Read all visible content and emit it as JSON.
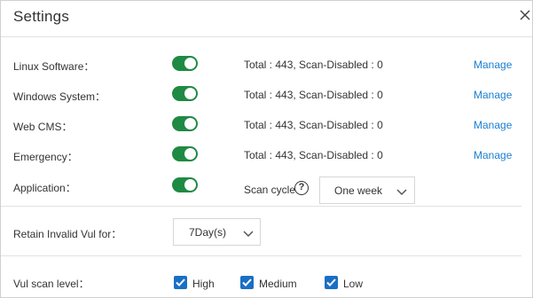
{
  "dialog": {
    "title": "Settings"
  },
  "rows": [
    {
      "label": "Linux Software：",
      "stats": "Total : 443, Scan-Disabled : 0",
      "action": "Manage",
      "enabled": true
    },
    {
      "label": "Windows System：",
      "stats": "Total : 443, Scan-Disabled : 0",
      "action": "Manage",
      "enabled": true
    },
    {
      "label": "Web CMS：",
      "stats": "Total : 443, Scan-Disabled : 0",
      "action": "Manage",
      "enabled": true
    },
    {
      "label": "Emergency：",
      "stats": "Total : 443, Scan-Disabled : 0",
      "action": "Manage",
      "enabled": true
    },
    {
      "label": "Application：",
      "enabled": true,
      "scan_cycle_label": "Scan cycle",
      "scan_cycle_value": "One week"
    }
  ],
  "retain": {
    "label": "Retain Invalid Vul for：",
    "value": "7Day(s)"
  },
  "scan_level": {
    "label": "Vul scan level：",
    "options": [
      {
        "label": "High",
        "checked": true
      },
      {
        "label": "Medium",
        "checked": true
      },
      {
        "label": "Low",
        "checked": true
      }
    ]
  },
  "colors": {
    "toggle_on": "#1f8a43",
    "link": "#1a7fd0",
    "checkbox": "#1a6fc4"
  },
  "icons": {
    "close": "close-icon",
    "help": "help-icon",
    "chevron": "chevron-down-icon",
    "check": "checkmark-icon"
  }
}
